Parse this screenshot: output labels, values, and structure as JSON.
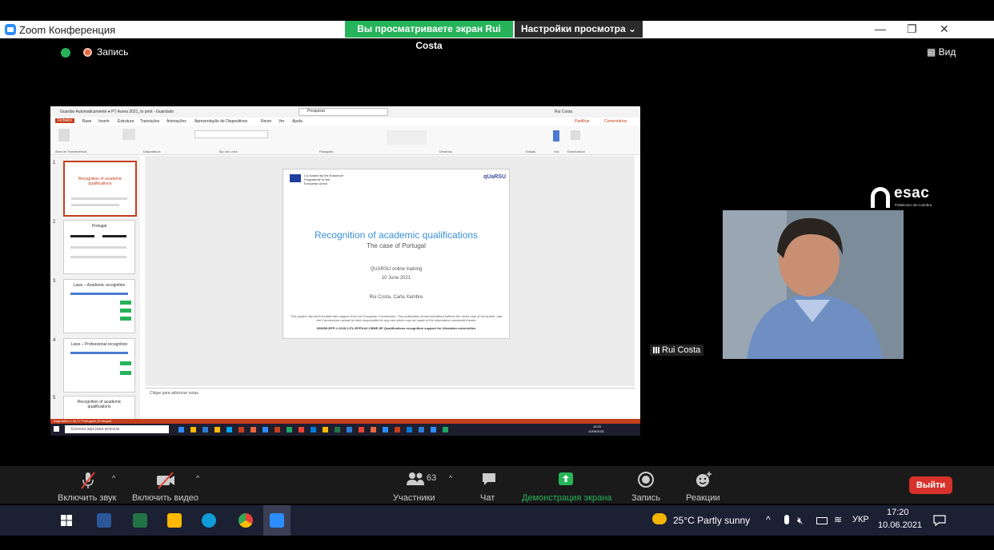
{
  "window": {
    "title": "Zoom Конференция",
    "share_banner": "Вы просматриваете экран Rui Costa",
    "view_settings": "Настройки просмотра ⌄",
    "minimize": "—",
    "restore": "❐",
    "close": "✕"
  },
  "overlay": {
    "recording_label": "Запись",
    "view_label": "Вид"
  },
  "shared_screen": {
    "ppt_titlebar": "Guardar Automaticamente  ●  PT Aurea 2021_to print - Guardado",
    "ppt_search": "Pesquisar",
    "ppt_user": "Rui Costa",
    "menu": [
      "Ficheiro",
      "Base",
      "Inserir",
      "Estrutura",
      "Transições",
      "Animações",
      "Apresentação de Diapositivos",
      "Rever",
      "Ver",
      "Ajuda"
    ],
    "share_btn": "Partilhar",
    "comments_btn": "Comentários",
    "ribbon_groups": [
      "Área de Transferência",
      "Diapositivos",
      "Tipo de Letra",
      "Parágrafo",
      "Desenho",
      "Edição",
      "Voz",
      "Estruturador"
    ],
    "thumbnails": [
      {
        "num": "1",
        "title": "Recognition of academic qualifications"
      },
      {
        "num": "2",
        "title": "Portugal"
      },
      {
        "num": "3",
        "title": "Laws – Academic recognition"
      },
      {
        "num": "4",
        "title": "Laws – Professional recognition"
      },
      {
        "num": "5",
        "title": "Recognition of academic qualifications"
      }
    ],
    "slide": {
      "eu_text": "Co-funded by the Erasmus+ Programme of the European Union",
      "logo": "qUaRSU",
      "title": "Recognition of academic qualifications",
      "subtitle": "The case of Portugal",
      "training": "QUARSU online training",
      "date": "10 June 2021",
      "authors": "Rui Costa, Carla Xambre",
      "disclaimer": "This project has been funded with support from the European Commission. This publication [communication] reflects the views only of the author, and the Commission cannot be held responsible for any use which may be made of the information contained therein",
      "project_code": "609990-EPP-1-2019-1-PL-EPPKA2-CBHE-SP Qualifications recognition support for Ukrainian universities"
    },
    "notes_placeholder": "Clique para adicionar notas",
    "status": "Diapositivo 1 de 17   Português (Portugal)",
    "taskbar_search": "Escreva aqui para procurar",
    "taskbar_time": "15:20",
    "taskbar_date": "10/06/2021"
  },
  "participant": {
    "name": "Rui Costa",
    "org_logo": "esac",
    "org_sub": "Politécnico de Coimbra"
  },
  "controls": {
    "mute": "Включить звук",
    "video": "Включить видео",
    "participants": "Участники",
    "participants_count": "63",
    "chat": "Чат",
    "share": "Демонстрация экрана",
    "record": "Запись",
    "reactions": "Реакции",
    "leave": "Выйти"
  },
  "taskbar": {
    "weather": "25°C  Partly sunny",
    "language": "УКР",
    "time": "17:20",
    "date": "10.06.2021"
  },
  "colors": {
    "share_green": "#27b35a",
    "leave_red": "#d6322b",
    "ppt_red": "#c43e1c"
  }
}
